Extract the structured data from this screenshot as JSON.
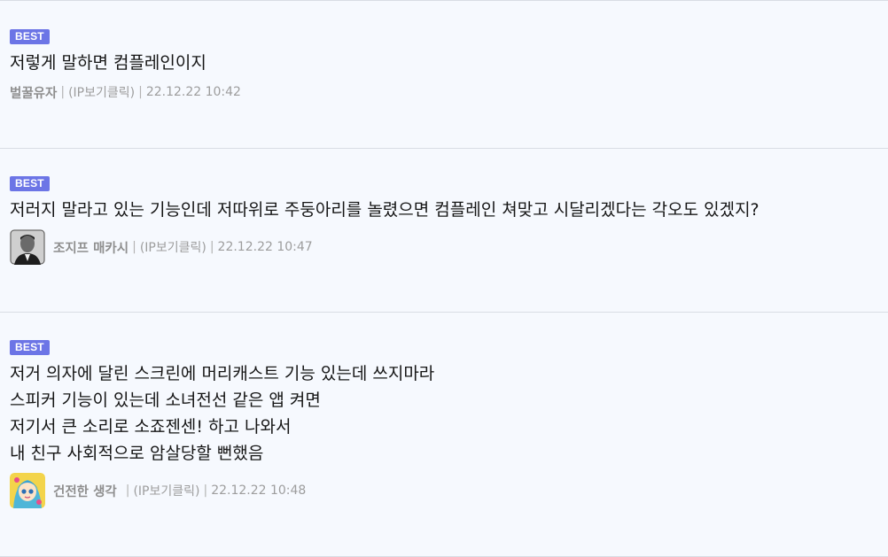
{
  "comments": [
    {
      "badge": "BEST",
      "text": "저렇게 말하면 컴플레인이지",
      "nickname": "벌꿀유자",
      "ip_link": "(IP보기클릭)",
      "date": "22.12.22 10:42",
      "separator": "|",
      "avatar": null
    },
    {
      "badge": "BEST",
      "text": "저러지 말라고 있는 기능인데 저따위로 주둥아리를 놀렸으면 컴플레인 쳐맞고 시달리겠다는 각오도 있겠지?",
      "nickname": "조지프 매카시",
      "ip_link": "(IP보기클릭)",
      "date": "22.12.22 10:47",
      "separator": "|",
      "avatar": "portrait-avatar-icon"
    },
    {
      "badge": "BEST",
      "text": "저거 의자에 달린 스크린에 머리캐스트 기능 있는데 쓰지마라\n스피커 기능이 있는데 소녀전선 같은 앱 켜면\n저기서 큰 소리로 소죠젠센! 하고 나와서\n내 친구 사회적으로 암살당할 뻔했음",
      "nickname": "건전한 생각",
      "ip_link": "(IP보기클릭)",
      "date": "22.12.22 10:48",
      "separator": "|",
      "avatar": "anime-avatar-icon"
    }
  ],
  "colors": {
    "background": "#f6f9fe",
    "badge": "#6c75e6",
    "divider": "#d9dde4",
    "meta_text": "#9b9b9b"
  }
}
